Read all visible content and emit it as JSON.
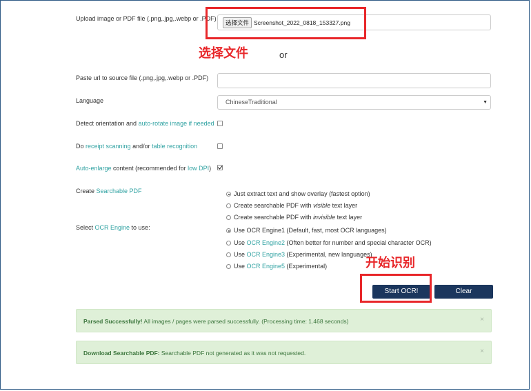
{
  "form": {
    "upload_label": "Upload image or PDF file (.png,.jpg,.webp or .PDF)",
    "file_button": "选择文件",
    "file_name": "Screenshot_2022_0818_153327.png",
    "or_text": "or",
    "url_label": "Paste url to source file (.png,.jpg,.webp or .PDF)",
    "url_value": "",
    "language_label": "Language",
    "language_selected": "ChineseTraditional",
    "detect_prefix": "Detect orientation and ",
    "detect_link": "auto-rotate image if needed",
    "receipt_prefix": "Do ",
    "receipt_link": "receipt scanning",
    "receipt_mid": " and/or ",
    "table_link": "table recognition",
    "enlarge_link": "Auto-enlarge",
    "enlarge_mid": " content (recommended for ",
    "lowdpi_link": "low DPI",
    "enlarge_end": ")",
    "create_prefix": "Create ",
    "create_link": "Searchable PDF",
    "engine_prefix": "Select ",
    "engine_link": "OCR Engine",
    "engine_suffix": " to use:",
    "pdf_options": [
      {
        "pre": "Just extract text and show overlay (fastest option)",
        "em": "",
        "post": "",
        "selected": true
      },
      {
        "pre": "Create searchable PDF with ",
        "em": "visible",
        "post": " text layer",
        "selected": false
      },
      {
        "pre": "Create searchable PDF with ",
        "em": "invisible",
        "post": " text layer",
        "selected": false
      }
    ],
    "engine_options": [
      {
        "pre": "Use ",
        "link": "",
        "text": "OCR Engine1 (Default, fast, most OCR languages)",
        "selected": true
      },
      {
        "pre": "Use ",
        "link": "OCR Engine2",
        "text": " (Often better for number and special character OCR)",
        "selected": false
      },
      {
        "pre": "Use ",
        "link": "OCR Engine3",
        "text": " (Experimental, new languages)",
        "selected": false
      },
      {
        "pre": "Use ",
        "link": "OCR Engine5",
        "text": " (Experimental)",
        "selected": false
      }
    ],
    "start_button": "Start OCR!",
    "clear_button": "Clear"
  },
  "checkboxes": {
    "detect_checked": false,
    "receipt_checked": false,
    "enlarge_checked": true
  },
  "alerts": {
    "parsed_bold": "Parsed Successfully!",
    "parsed_text": " All images / pages were parsed successfully. (Processing time: 1.468 seconds)",
    "download_bold": "Download Searchable PDF:",
    "download_text": " Searchable PDF not generated as it was not requested.",
    "close_symbol": "×"
  },
  "annotations": {
    "choose_file": "选择文件",
    "start_recognition": "开始识别"
  },
  "colors": {
    "accent_link": "#32a3a3",
    "button": "#1b365d",
    "annotation_red": "#e8272a",
    "alert_bg": "#dff0d8"
  }
}
